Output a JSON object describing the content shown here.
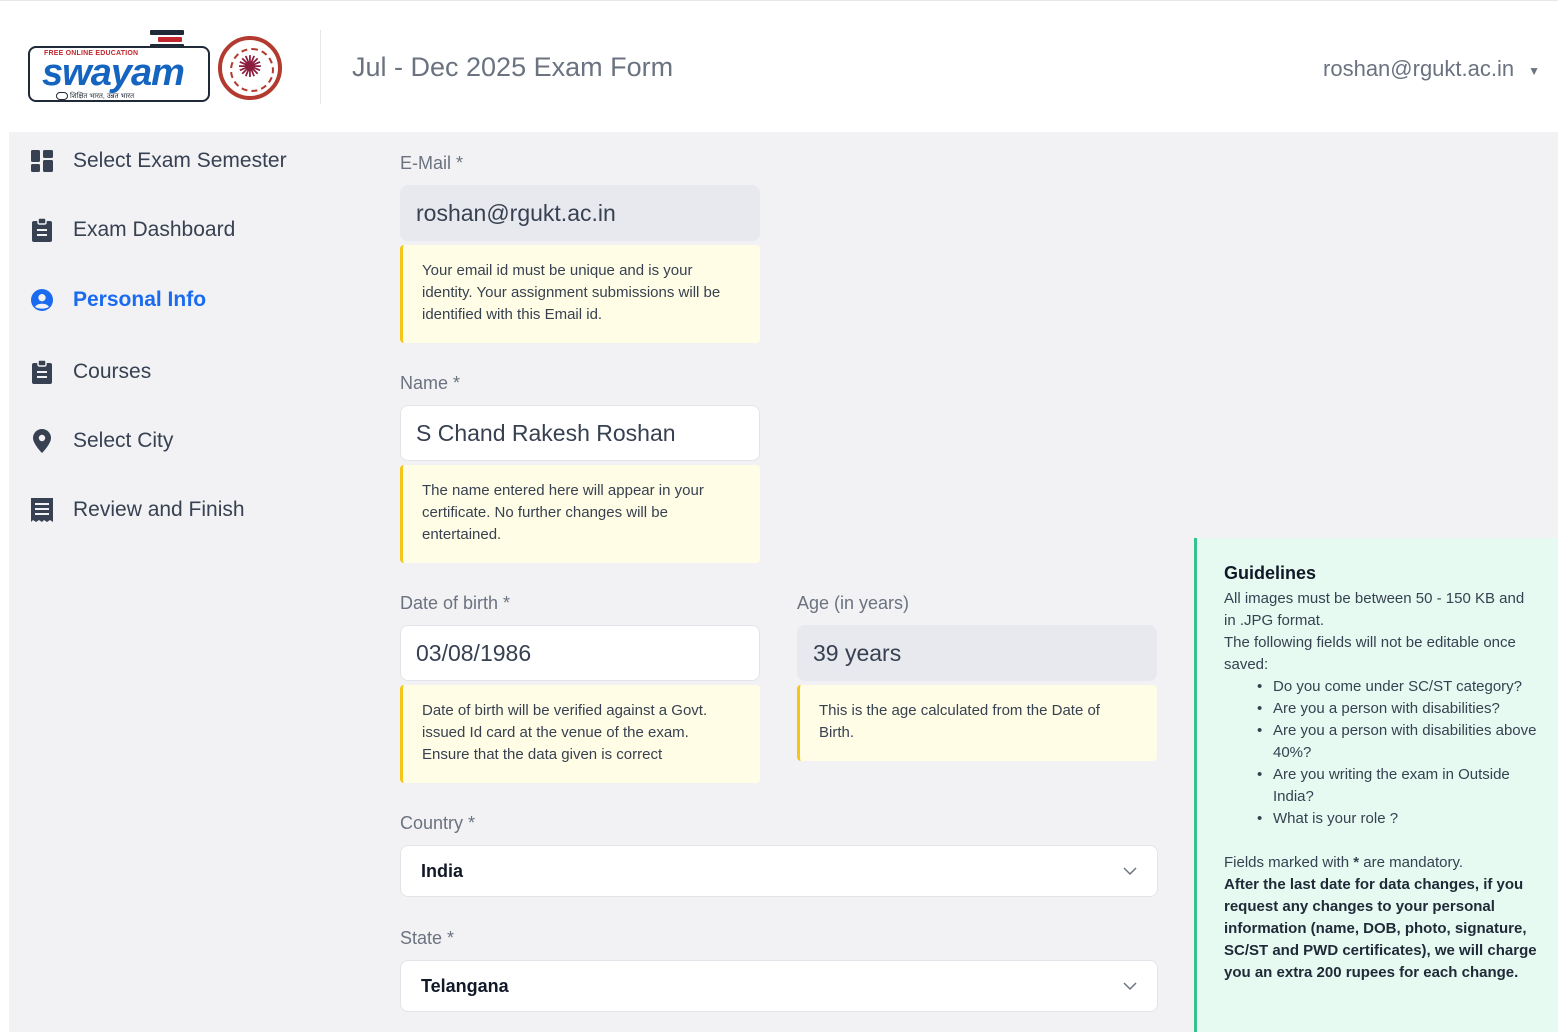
{
  "header": {
    "logo_top_text": "FREE ONLINE EDUCATION",
    "logo_word": "swayam",
    "logo_tagline": "शिक्षित भारत, उन्नत भारत",
    "title": "Jul - Dec 2025 Exam Form",
    "user_email": "roshan@rgukt.ac.in"
  },
  "sidebar": {
    "items": [
      {
        "label": "Select Exam Semester",
        "icon": "dashboard-grid-icon",
        "active": false
      },
      {
        "label": "Exam Dashboard",
        "icon": "clipboard-icon",
        "active": false
      },
      {
        "label": "Personal Info",
        "icon": "user-circle-icon",
        "active": true
      },
      {
        "label": "Courses",
        "icon": "clipboard-icon",
        "active": false
      },
      {
        "label": "Select City",
        "icon": "map-pin-icon",
        "active": false
      },
      {
        "label": "Review and Finish",
        "icon": "receipt-icon",
        "active": false
      }
    ]
  },
  "form": {
    "email": {
      "label": "E-Mail *",
      "value": "roshan@rgukt.ac.in",
      "note": "Your email id must be unique and is your identity. Your assignment submissions will be identified with this Email id."
    },
    "name": {
      "label": "Name *",
      "value": "S Chand Rakesh Roshan",
      "note": "The name entered here will appear in your certificate. No further changes will be entertained."
    },
    "dob": {
      "label": "Date of birth *",
      "value": "03/08/1986",
      "note": "Date of birth will be verified against a Govt. issued Id card at the venue of the exam. Ensure that the data given is correct"
    },
    "age": {
      "label": "Age (in years)",
      "value": "39 years",
      "note": "This is the age calculated from the Date of Birth."
    },
    "country": {
      "label": "Country *",
      "value": "India"
    },
    "state": {
      "label": "State *",
      "value": "Telangana"
    }
  },
  "guidelines": {
    "title": "Guidelines",
    "line1": "All images must be between 50 - 150 KB and in .JPG format.",
    "line2": "The following fields will not be editable once saved:",
    "items": [
      "Do you come under SC/ST category?",
      "Are you a person with disabilities?",
      "Are you a person with disabilities above 40%?",
      "Are you writing the exam in Outside India?",
      "What is your role ?"
    ],
    "mandatory_prefix": "Fields marked with ",
    "mandatory_star": "*",
    "mandatory_suffix": " are mandatory.",
    "charge_note": "After the last date for data changes, if you request any changes to your personal information (name, DOB, photo, signature, SC/ST and PWD certificates), we will charge you an extra 200 rupees for each change."
  },
  "colors": {
    "accent": "#1a6bf0",
    "note_bg": "#fffde5",
    "note_border": "#f5c518",
    "guide_bg": "#e6faf1",
    "guide_border": "#34c38f"
  }
}
